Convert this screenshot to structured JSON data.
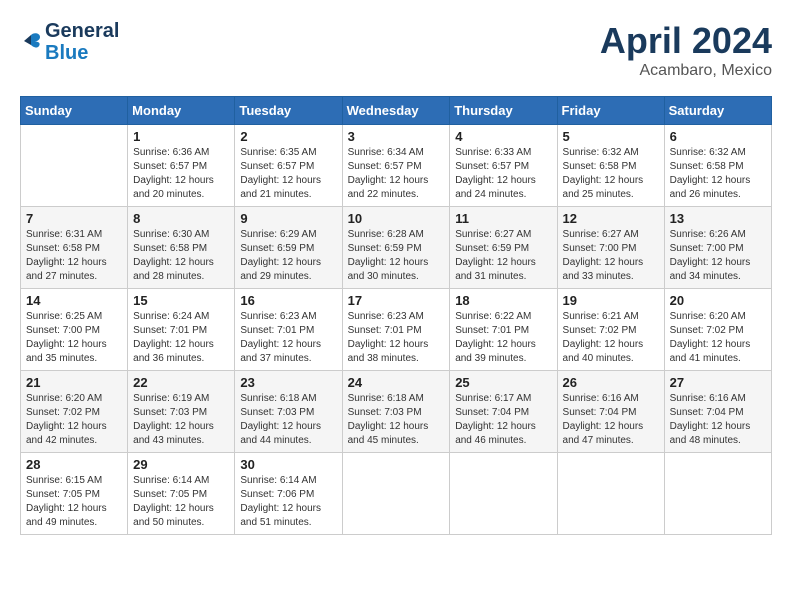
{
  "header": {
    "logo_line1": "General",
    "logo_line2": "Blue",
    "month": "April 2024",
    "location": "Acambaro, Mexico"
  },
  "weekdays": [
    "Sunday",
    "Monday",
    "Tuesday",
    "Wednesday",
    "Thursday",
    "Friday",
    "Saturday"
  ],
  "weeks": [
    [
      {
        "day": "",
        "info": ""
      },
      {
        "day": "1",
        "info": "Sunrise: 6:36 AM\nSunset: 6:57 PM\nDaylight: 12 hours\nand 20 minutes."
      },
      {
        "day": "2",
        "info": "Sunrise: 6:35 AM\nSunset: 6:57 PM\nDaylight: 12 hours\nand 21 minutes."
      },
      {
        "day": "3",
        "info": "Sunrise: 6:34 AM\nSunset: 6:57 PM\nDaylight: 12 hours\nand 22 minutes."
      },
      {
        "day": "4",
        "info": "Sunrise: 6:33 AM\nSunset: 6:57 PM\nDaylight: 12 hours\nand 24 minutes."
      },
      {
        "day": "5",
        "info": "Sunrise: 6:32 AM\nSunset: 6:58 PM\nDaylight: 12 hours\nand 25 minutes."
      },
      {
        "day": "6",
        "info": "Sunrise: 6:32 AM\nSunset: 6:58 PM\nDaylight: 12 hours\nand 26 minutes."
      }
    ],
    [
      {
        "day": "7",
        "info": "Sunrise: 6:31 AM\nSunset: 6:58 PM\nDaylight: 12 hours\nand 27 minutes."
      },
      {
        "day": "8",
        "info": "Sunrise: 6:30 AM\nSunset: 6:58 PM\nDaylight: 12 hours\nand 28 minutes."
      },
      {
        "day": "9",
        "info": "Sunrise: 6:29 AM\nSunset: 6:59 PM\nDaylight: 12 hours\nand 29 minutes."
      },
      {
        "day": "10",
        "info": "Sunrise: 6:28 AM\nSunset: 6:59 PM\nDaylight: 12 hours\nand 30 minutes."
      },
      {
        "day": "11",
        "info": "Sunrise: 6:27 AM\nSunset: 6:59 PM\nDaylight: 12 hours\nand 31 minutes."
      },
      {
        "day": "12",
        "info": "Sunrise: 6:27 AM\nSunset: 7:00 PM\nDaylight: 12 hours\nand 33 minutes."
      },
      {
        "day": "13",
        "info": "Sunrise: 6:26 AM\nSunset: 7:00 PM\nDaylight: 12 hours\nand 34 minutes."
      }
    ],
    [
      {
        "day": "14",
        "info": "Sunrise: 6:25 AM\nSunset: 7:00 PM\nDaylight: 12 hours\nand 35 minutes."
      },
      {
        "day": "15",
        "info": "Sunrise: 6:24 AM\nSunset: 7:01 PM\nDaylight: 12 hours\nand 36 minutes."
      },
      {
        "day": "16",
        "info": "Sunrise: 6:23 AM\nSunset: 7:01 PM\nDaylight: 12 hours\nand 37 minutes."
      },
      {
        "day": "17",
        "info": "Sunrise: 6:23 AM\nSunset: 7:01 PM\nDaylight: 12 hours\nand 38 minutes."
      },
      {
        "day": "18",
        "info": "Sunrise: 6:22 AM\nSunset: 7:01 PM\nDaylight: 12 hours\nand 39 minutes."
      },
      {
        "day": "19",
        "info": "Sunrise: 6:21 AM\nSunset: 7:02 PM\nDaylight: 12 hours\nand 40 minutes."
      },
      {
        "day": "20",
        "info": "Sunrise: 6:20 AM\nSunset: 7:02 PM\nDaylight: 12 hours\nand 41 minutes."
      }
    ],
    [
      {
        "day": "21",
        "info": "Sunrise: 6:20 AM\nSunset: 7:02 PM\nDaylight: 12 hours\nand 42 minutes."
      },
      {
        "day": "22",
        "info": "Sunrise: 6:19 AM\nSunset: 7:03 PM\nDaylight: 12 hours\nand 43 minutes."
      },
      {
        "day": "23",
        "info": "Sunrise: 6:18 AM\nSunset: 7:03 PM\nDaylight: 12 hours\nand 44 minutes."
      },
      {
        "day": "24",
        "info": "Sunrise: 6:18 AM\nSunset: 7:03 PM\nDaylight: 12 hours\nand 45 minutes."
      },
      {
        "day": "25",
        "info": "Sunrise: 6:17 AM\nSunset: 7:04 PM\nDaylight: 12 hours\nand 46 minutes."
      },
      {
        "day": "26",
        "info": "Sunrise: 6:16 AM\nSunset: 7:04 PM\nDaylight: 12 hours\nand 47 minutes."
      },
      {
        "day": "27",
        "info": "Sunrise: 6:16 AM\nSunset: 7:04 PM\nDaylight: 12 hours\nand 48 minutes."
      }
    ],
    [
      {
        "day": "28",
        "info": "Sunrise: 6:15 AM\nSunset: 7:05 PM\nDaylight: 12 hours\nand 49 minutes."
      },
      {
        "day": "29",
        "info": "Sunrise: 6:14 AM\nSunset: 7:05 PM\nDaylight: 12 hours\nand 50 minutes."
      },
      {
        "day": "30",
        "info": "Sunrise: 6:14 AM\nSunset: 7:06 PM\nDaylight: 12 hours\nand 51 minutes."
      },
      {
        "day": "",
        "info": ""
      },
      {
        "day": "",
        "info": ""
      },
      {
        "day": "",
        "info": ""
      },
      {
        "day": "",
        "info": ""
      }
    ]
  ]
}
